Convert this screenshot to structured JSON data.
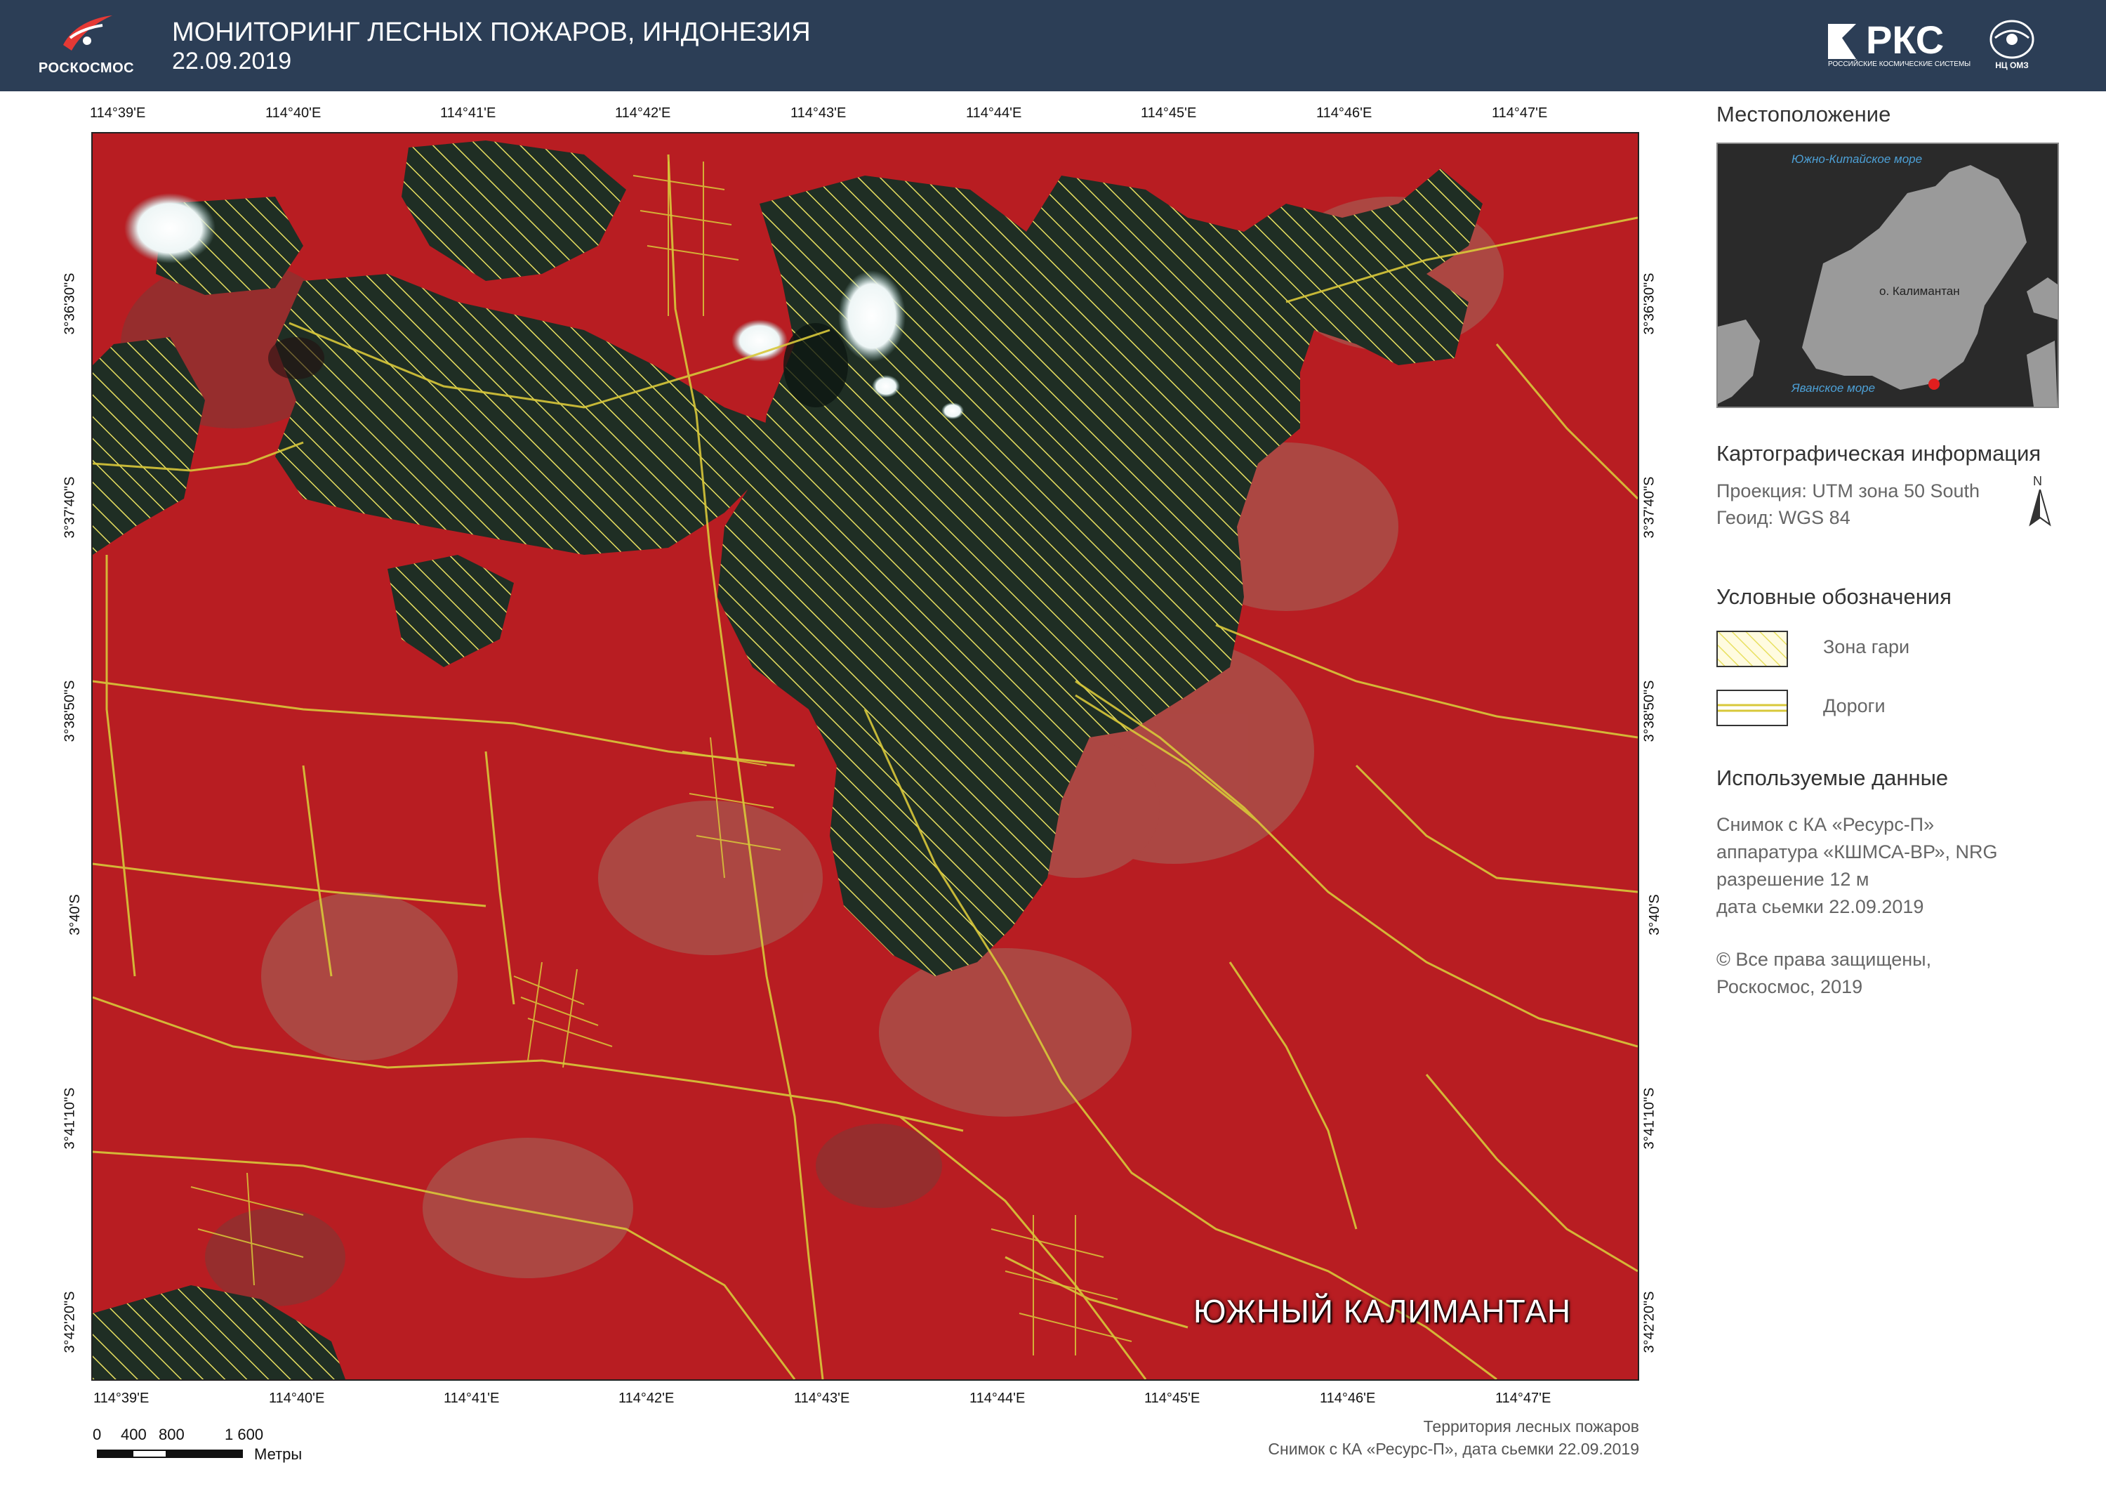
{
  "header": {
    "agency_logo_text": "РОСКОСМОС",
    "title": "МОНИТОРИНГ ЛЕСНЫХ ПОЖАРОВ, ИНДОНЕЗИЯ",
    "date": "22.09.2019",
    "rks_logo_text": "РКС",
    "rks_logo_sub": "РОССИЙСКИЕ КОСМИЧЕСКИЕ СИСТЕМЫ",
    "omz_logo_text": "НЦ ОМЗ"
  },
  "map": {
    "lon_labels": [
      "114°39'E",
      "114°40'E",
      "114°41'E",
      "114°42'E",
      "114°43'E",
      "114°44'E",
      "114°45'E",
      "114°46'E",
      "114°47'E"
    ],
    "lat_labels": [
      "3°36'30\"S",
      "3°37'40\"S",
      "3°38'50\"S",
      "3°40'S",
      "3°41'10\"S",
      "3°42'20\"S"
    ],
    "region_label": "ЮЖНЫЙ КАЛИМАНТАН"
  },
  "scale_bar": {
    "ticks": [
      "0",
      "400",
      "800",
      "1 600"
    ],
    "unit": "Метры"
  },
  "credits": {
    "line1": "Территория лесных пожаров",
    "line2": "Снимок с КА «Ресурс-П», дата сьемки 22.09.2019"
  },
  "panel": {
    "location_title": "Местоположение",
    "inset": {
      "sea_north": "Южно-Китайское море",
      "island": "о. Калимантан",
      "sea_south": "Яванское море"
    },
    "carto_title": "Картографическая информация",
    "projection": "Проекция: UTM зона 50 South",
    "geoid": "Геоид: WGS 84",
    "north_symbol": "N",
    "legend_title": "Условные обозначения",
    "legend": [
      {
        "label": "Зона гари"
      },
      {
        "label": "Дороги"
      }
    ],
    "data_title": "Используемые данные",
    "data_lines": [
      "Снимок с КА «Ресурс-П»",
      "аппаратура «КШМСА-ВР», NRG",
      "разрешение 12 м",
      "дата сьемки 22.09.2019"
    ],
    "copyright_lines": [
      "© Все права защищены,",
      "Роскосмос, 2019"
    ]
  },
  "colors": {
    "header_bg": "#2c3e56",
    "vegetation_red": "#b81d22",
    "burn_dark": "#1f2e24",
    "hatch_yellow": "#e8e060",
    "roads_yellow": "#d8c83a",
    "inset_land": "#9a9a9a",
    "inset_sea_label": "#4da0d6",
    "location_marker": "#e01e1e"
  }
}
